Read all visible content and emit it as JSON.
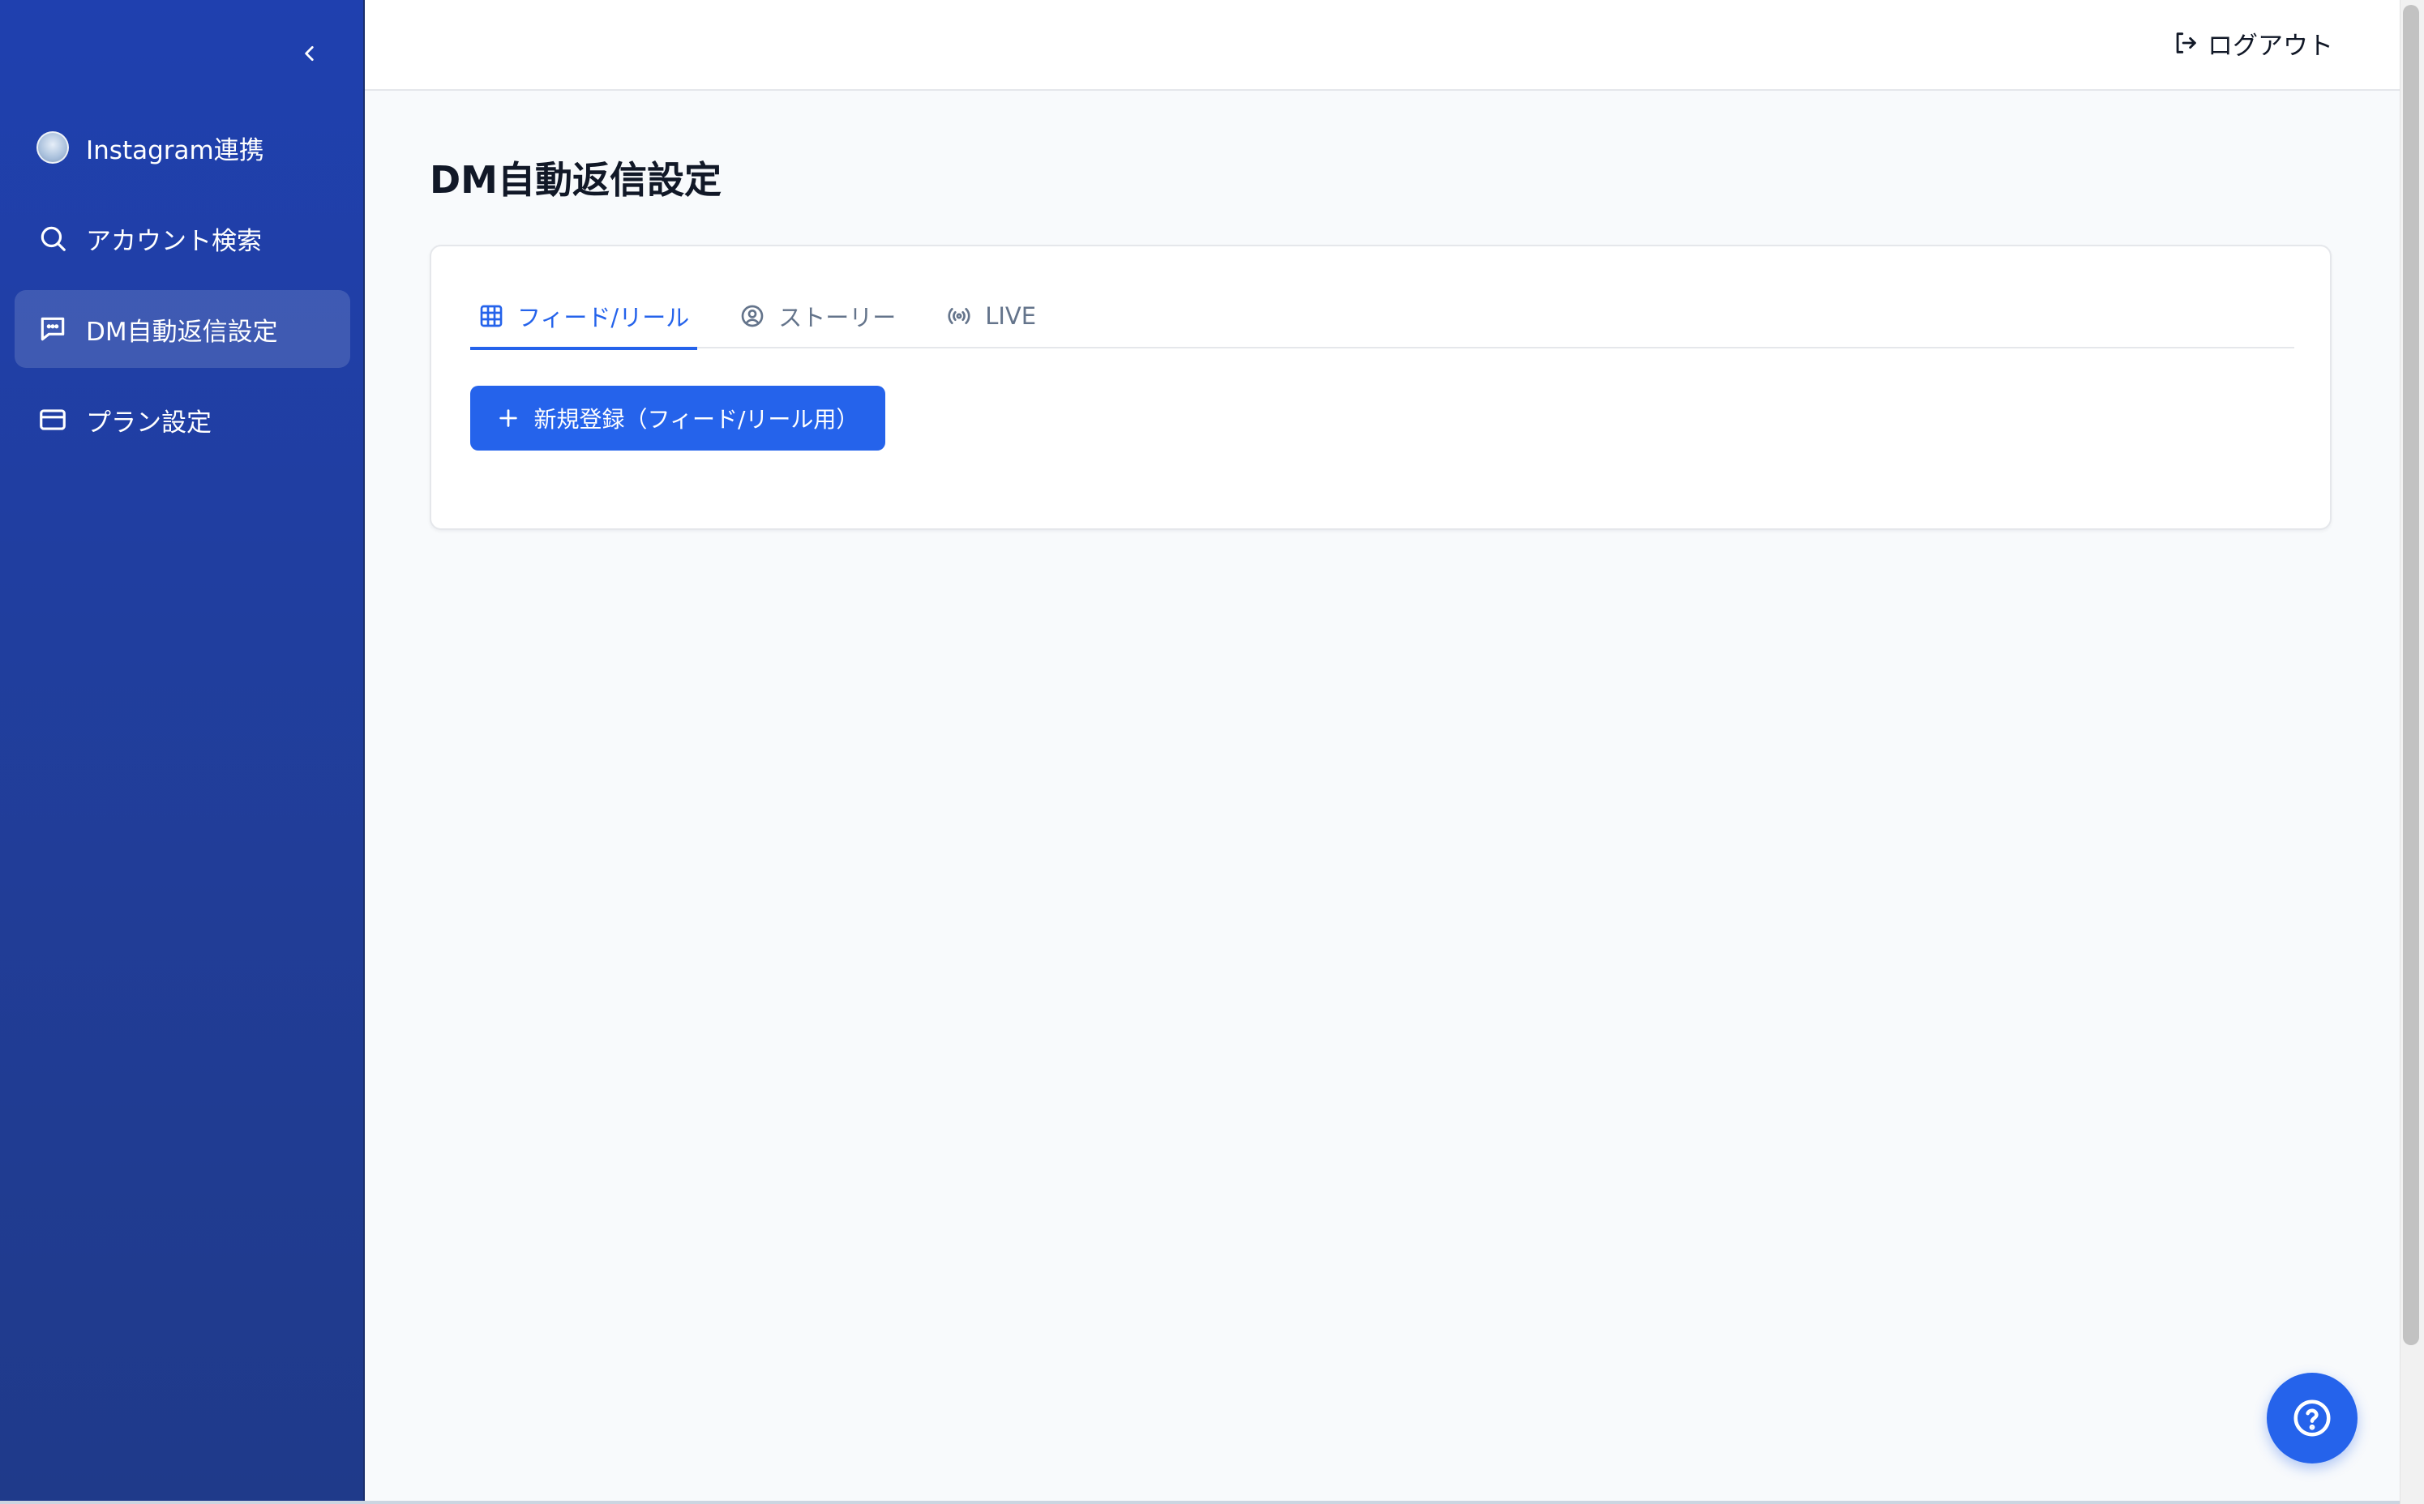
{
  "sidebar": {
    "items": [
      {
        "label": "Instagram連携",
        "icon": "instagram-avatar"
      },
      {
        "label": "アカウント検索",
        "icon": "search-icon"
      },
      {
        "label": "DM自動返信設定",
        "icon": "message-icon",
        "active": true
      },
      {
        "label": "プラン設定",
        "icon": "credit-card-icon"
      }
    ]
  },
  "header": {
    "logout_label": "ログアウト"
  },
  "main": {
    "title": "DM自動返信設定",
    "tabs": [
      {
        "label": "フィード/リール",
        "icon": "grid-icon",
        "active": true
      },
      {
        "label": "ストーリー",
        "icon": "user-circle-icon"
      },
      {
        "label": "LIVE",
        "icon": "broadcast-icon"
      }
    ],
    "new_button_label": "新規登録（フィード/リール用）"
  },
  "colors": {
    "accent": "#2563eb",
    "sidebar": "#1f40af"
  }
}
